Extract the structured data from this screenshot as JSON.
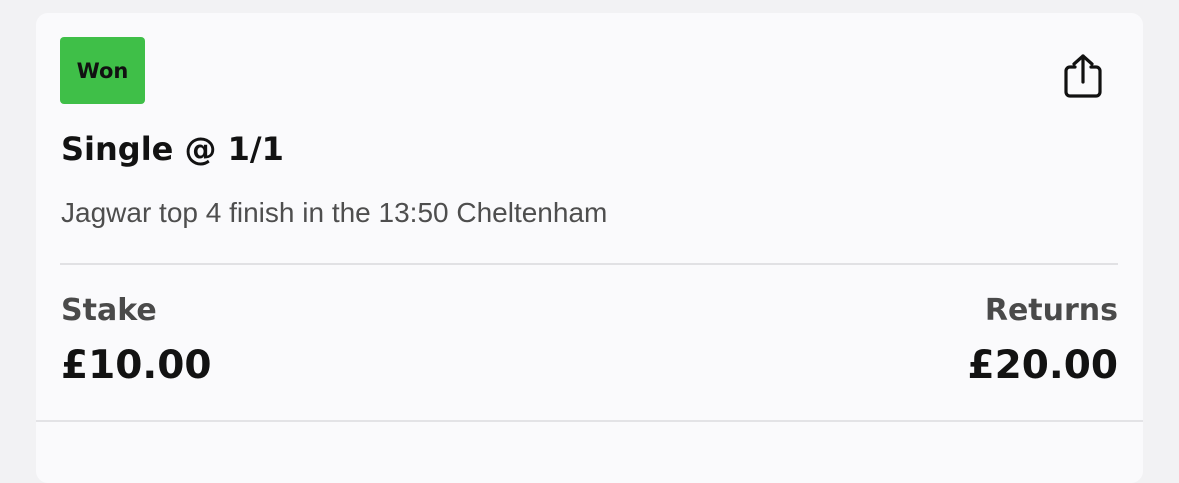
{
  "bet": {
    "status": "Won",
    "status_color": "#3fbf48",
    "title": "Single @ 1/1",
    "description": "Jagwar top 4 finish in the 13:50 Cheltenham",
    "stake_label": "Stake",
    "stake_value": "£10.00",
    "returns_label": "Returns",
    "returns_value": "£20.00"
  },
  "share_icon": "share-icon"
}
